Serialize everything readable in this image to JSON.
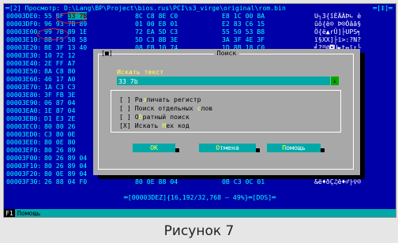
{
  "title_bar": {
    "label": "═[2] Просмотр: D:\\Lang\\BP\\Project\\bios.rus\\PCI\\s3_virge\\original\\rom.bin",
    "controls": "═[‡]═"
  },
  "rows": [
    {
      "addr": "00003DE0:",
      "h1": "55 BF 33 7B",
      "h2": "8C C8 8E C0",
      "h3": "E8 1C 00 8A",
      "asc": "U┐3{îÈÄÀÞ∟ è"
    },
    {
      "addr": "00003DF0:",
      "h1": "96 93 7B 89",
      "h2": "01 00 E8 01",
      "h3": "E2 83 C6 15",
      "asc": "ûô{ë☺ Þ☺Ôâã§"
    },
    {
      "addr": "00003E00:",
      "h1": "99 7B 89 1E",
      "h2": "72 EA 5D C3",
      "h3": "55 50 53 B8",
      "asc": "Ö{ë▲rÛ]├UPS╕"
    },
    {
      "addr": "00003E10:",
      "h1": "8B F5 58 58",
      "h2": "5D C3 8B 3E",
      "h3": "3A 3F 4E 3F",
      "asc": "ï§XX]├ï>:?N?"
    },
    {
      "addr": "00003E20:",
      "h1": "BE 3F 13 40",
      "h2": "08 EB 10 74",
      "h3": "1D 8B 18 C0",
      "asc": "╛?‼@◘Ù►t↔ï↑└"
    },
    {
      "addr": "00003E30:",
      "h1": "10 72 12",
      "h2": "",
      "h3": "",
      "asc": "►r↕"
    },
    {
      "addr": "00003E40:",
      "h1": "2E FF A7",
      "h2": "",
      "h3": "",
      "asc": ".я║"
    },
    {
      "addr": "00003E50:",
      "h1": "8A C8 80",
      "h2": "",
      "h3": "",
      "asc": "èÈÇ"
    },
    {
      "addr": "00003E60:",
      "h1": "46 17 A0",
      "h2": "",
      "h3": "",
      "asc": "F↨á"
    },
    {
      "addr": "00003E70:",
      "h1": "1A C3 C3",
      "h2": "",
      "h3": "",
      "asc": "→├├"
    },
    {
      "addr": "00003E80:",
      "h1": "3F FB 3E",
      "h2": "",
      "h3": "",
      "asc": "?√>"
    },
    {
      "addr": "00003E90:",
      "h1": "06 87 04",
      "h2": "",
      "h3": "",
      "asc": "♠ç♦"
    },
    {
      "addr": "00003EA0:",
      "h1": "1E 87 04",
      "h2": "",
      "h3": "",
      "asc": "▲ç♦"
    },
    {
      "addr": "00003EB0:",
      "h1": "D1 E3 2E",
      "h2": "",
      "h3": "",
      "asc": "ÐÒ."
    },
    {
      "addr": "00003EC0:",
      "h1": "80 80 26",
      "h2": "",
      "h3": "",
      "asc": "ÇÇ&"
    },
    {
      "addr": "00003ED0:",
      "h1": "C3 80 0E",
      "h2": "",
      "h3": "",
      "asc": "├Ç♫"
    },
    {
      "addr": "00003EE0:",
      "h1": "80 0E 80",
      "h2": "",
      "h3": "",
      "asc": "Ç♫Ç"
    },
    {
      "addr": "00003EF0:",
      "h1": "80 26 89",
      "h2": "",
      "h3": "",
      "asc": "Ç&ë"
    },
    {
      "addr": "00003F00:",
      "h1": "80 26 89 04",
      "h2": "EF 80 26 88",
      "h3": "04 F0 80 0E",
      "asc": "Ç&ë♦ïÇ&ê♦ðÇ♫"
    },
    {
      "addr": "00003F10:",
      "h1": "80 26 89 04",
      "h2": "7F 80 0E 89",
      "h3": "04 10 80 26",
      "asc": "Ç&ë♦⌂Ç♫ë♦►Ç&"
    },
    {
      "addr": "00003F20:",
      "h1": "80 0E 89 04",
      "h2": "03 80 26 89",
      "h3": "04 7F 80 0E",
      "asc": "Ç♫ë♦♥Ç&ë♦⌂Ç♫"
    },
    {
      "addr": "00003F30:",
      "h1": "26 88 04 F0",
      "h2": "80 0E 88 04",
      "h3": "0B C3 0C 01",
      "asc": "&ê♦ðÇ♫ê♦♂├♀☺"
    }
  ],
  "status_bar": "═[00003DEZ]{16,192/32,768 – 49%}═[DOS]═",
  "keybar": {
    "key": "F1",
    "label": "Помощь"
  },
  "dialog": {
    "title": "Поиск",
    "close": "[■]",
    "search_label": "Искать текст",
    "search_value": "33 7b",
    "history_arrow": "↓",
    "options": [
      {
        "box": "[ ]",
        "pre": "Ра",
        "hk": "з",
        "post": "личать регистр"
      },
      {
        "box": "[ ]",
        "pre": "Поиск отдельных ",
        "hk": "с",
        "post": "лов"
      },
      {
        "box": "[ ]",
        "pre": "О",
        "hk": "б",
        "post": "ратный поиск"
      },
      {
        "box": "[X]",
        "pre": "Искать ",
        "hk": "Н",
        "post": "ex код"
      }
    ],
    "ok": "OK",
    "cancel_hk": "О",
    "cancel_rest": "тмена",
    "help_hk": "П",
    "help_rest": "омощь"
  },
  "caption": "Рисунок 7",
  "colors": {
    "screen_bg": "#0000a8",
    "text": "#00ffff",
    "dialog_bg": "#a8a8a8",
    "accent": "#ffff55",
    "input_bg": "#00a8a8",
    "annotation": "#d02828"
  }
}
